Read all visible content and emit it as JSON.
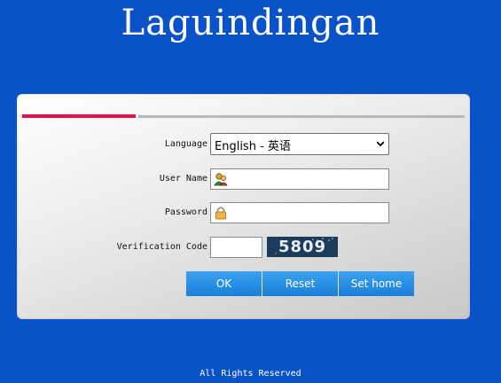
{
  "header": {
    "title": "Laguindingan"
  },
  "form": {
    "language_label": "Language",
    "language_selected": "English - 英语",
    "username_label": "User Name",
    "username_value": "",
    "password_label": "Password",
    "password_value": "",
    "verification_label": "Verification Code",
    "verification_value": "",
    "captcha_text": "5809"
  },
  "buttons": {
    "ok": "OK",
    "reset": "Reset",
    "set_home": "Set home"
  },
  "footer": {
    "text": "All Rights Reserved"
  },
  "colors": {
    "background": "#0a52c8",
    "accent_red": "#e8104a",
    "button_blue": "#1a7fd8"
  }
}
